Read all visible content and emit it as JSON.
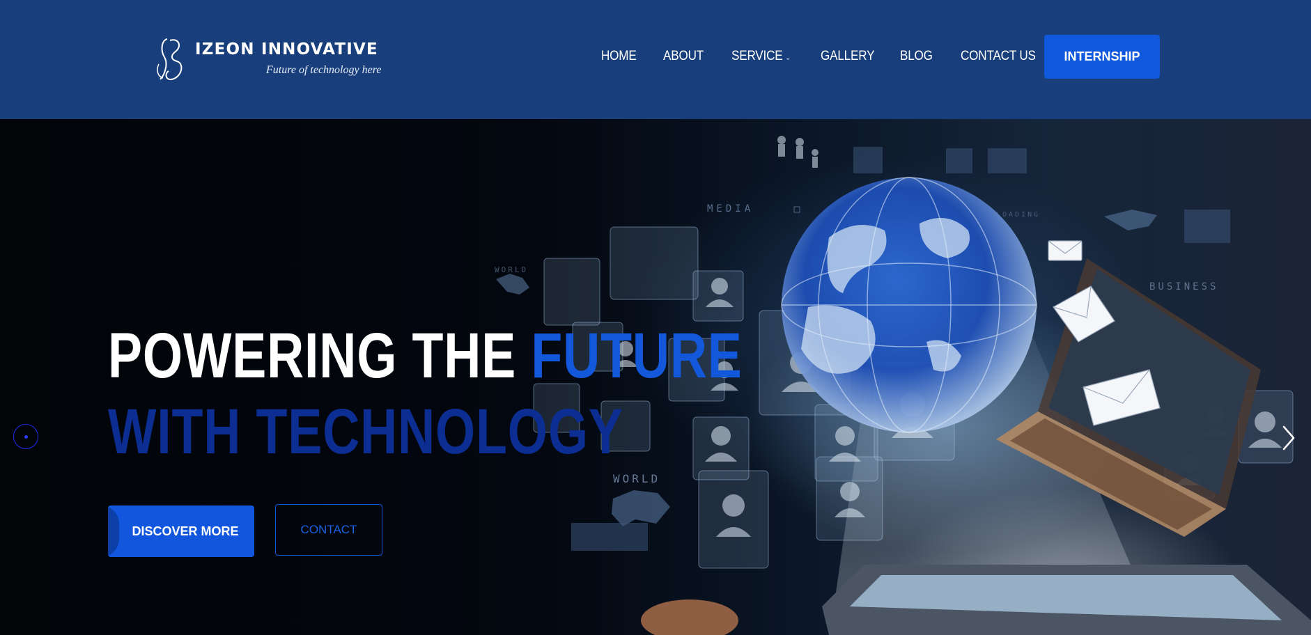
{
  "header": {
    "logo": {
      "name": "IZEON INNOVATIVE",
      "tagline": "Future of technology here"
    },
    "nav": [
      {
        "label": "HOME"
      },
      {
        "label": "ABOUT"
      },
      {
        "label": "SERVICE",
        "has_dropdown": true
      },
      {
        "label": "GALLERY"
      },
      {
        "label": "BLOG"
      },
      {
        "label": "CONTACT US"
      }
    ],
    "cta_label": "INTERNSHIP"
  },
  "hero": {
    "headline_part1": "POWERING THE ",
    "headline_accent": "FUTURE",
    "headline_line2": "WITH TECHNOLOGY",
    "primary_button": "DISCOVER MORE",
    "secondary_button": "CONTACT",
    "art_labels": {
      "media": "MEDIA",
      "loading": "LOADING",
      "business": "BUSINESS",
      "world": "WORLD"
    }
  },
  "colors": {
    "header_bg": "#183f7b",
    "accent_blue": "#1358da",
    "deep_blue": "#0c2e93",
    "white": "#ffffff"
  },
  "icons": [
    "logo-mark-icon",
    "chevron-down-icon",
    "carousel-prev-icon",
    "chevron-right-icon",
    "globe-icon",
    "laptop-icon",
    "tablet-icon",
    "envelope-icon",
    "person-icon"
  ]
}
